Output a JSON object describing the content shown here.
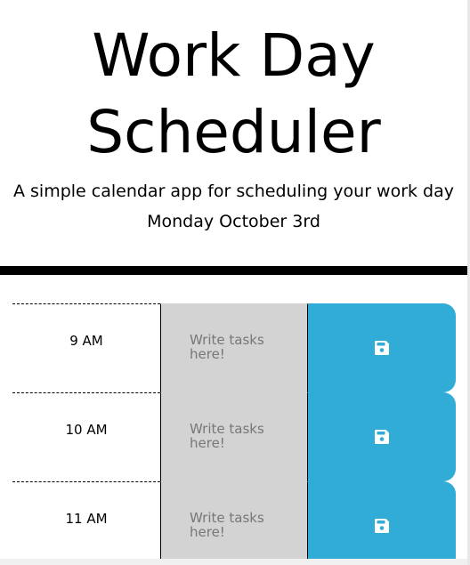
{
  "header": {
    "title": "Work Day Scheduler",
    "subtitle": "A simple calendar app for scheduling your work day",
    "current_day": "Monday October 3rd"
  },
  "schedule": {
    "placeholder": "Write tasks here!",
    "save_icon": "floppy-disk-icon",
    "hours": [
      {
        "label": "9 AM"
      },
      {
        "label": "10 AM"
      },
      {
        "label": "11 AM"
      }
    ]
  },
  "colors": {
    "save_button": "#31acd6",
    "description_bg": "#d3d3d3",
    "divider": "#000000"
  }
}
